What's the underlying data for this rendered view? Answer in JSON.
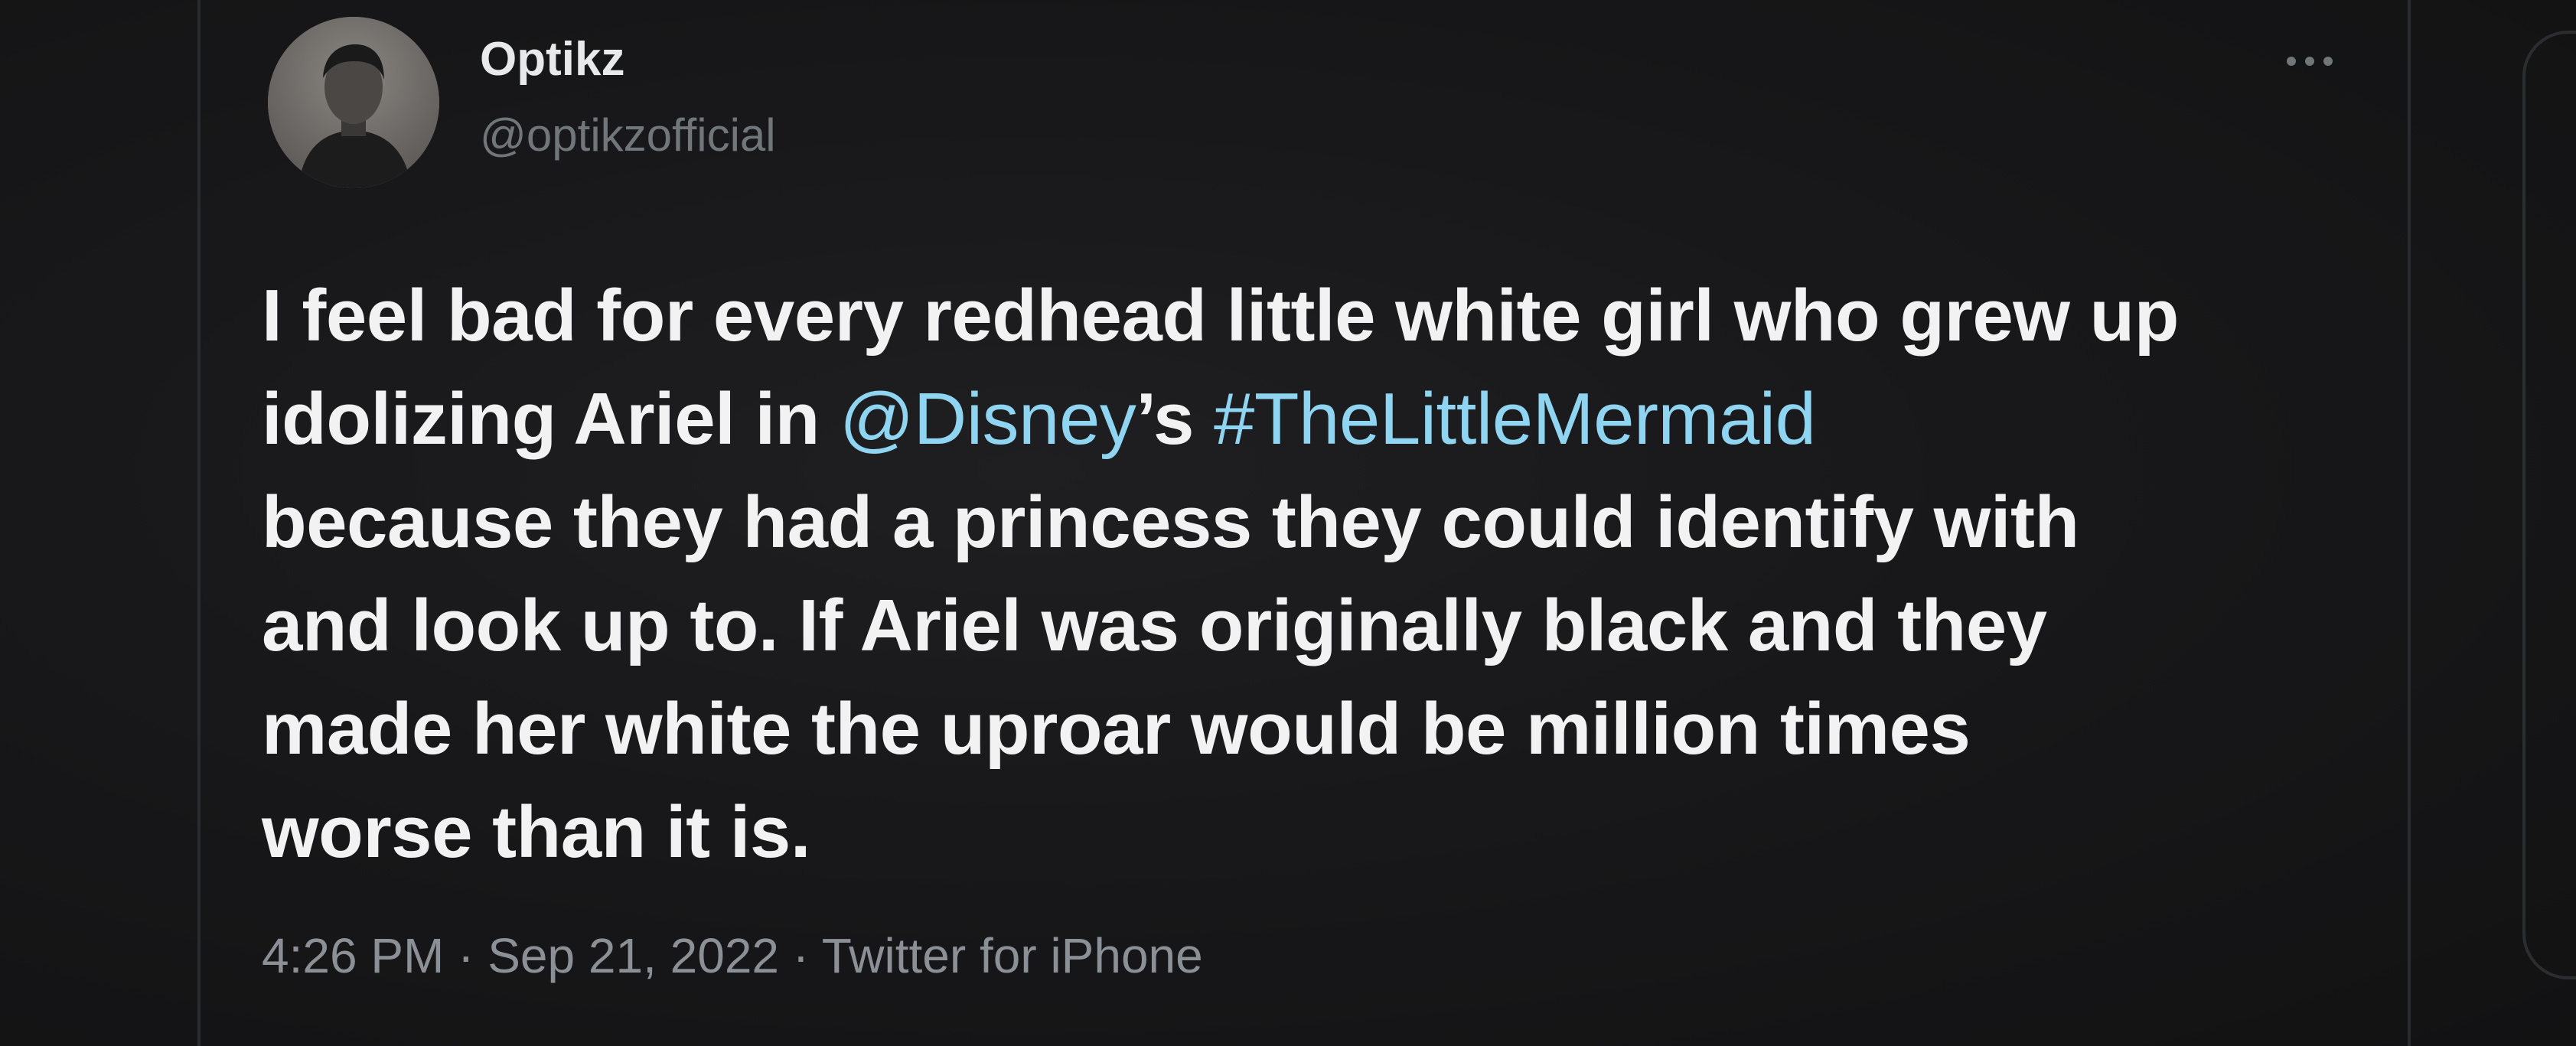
{
  "tweet": {
    "author": {
      "display_name": "Optikz",
      "handle": "@optikzofficial"
    },
    "more_icon": "more-horizontal-icon",
    "body": {
      "line1": "I feel bad for every redhead little white girl who grew up",
      "line2_prefix": "idolizing Ariel in ",
      "mention": "@Disney",
      "possessive": "’s ",
      "hashtag": "#TheLittleMermaid",
      "line3": "because they had a princess they could identify with",
      "line4": "and look up to. If Ariel was originally black and they",
      "line5": "made her white the uproar would be million times",
      "line6": "worse than it is."
    },
    "meta": {
      "time": "4:26 PM",
      "separator": " · ",
      "date": "Sep 21, 2022",
      "source": "Twitter for iPhone"
    }
  },
  "colors": {
    "background": "#18181a",
    "text": "#f2f2f2",
    "secondary_text": "#71767b",
    "link": "#8fd4f0"
  }
}
